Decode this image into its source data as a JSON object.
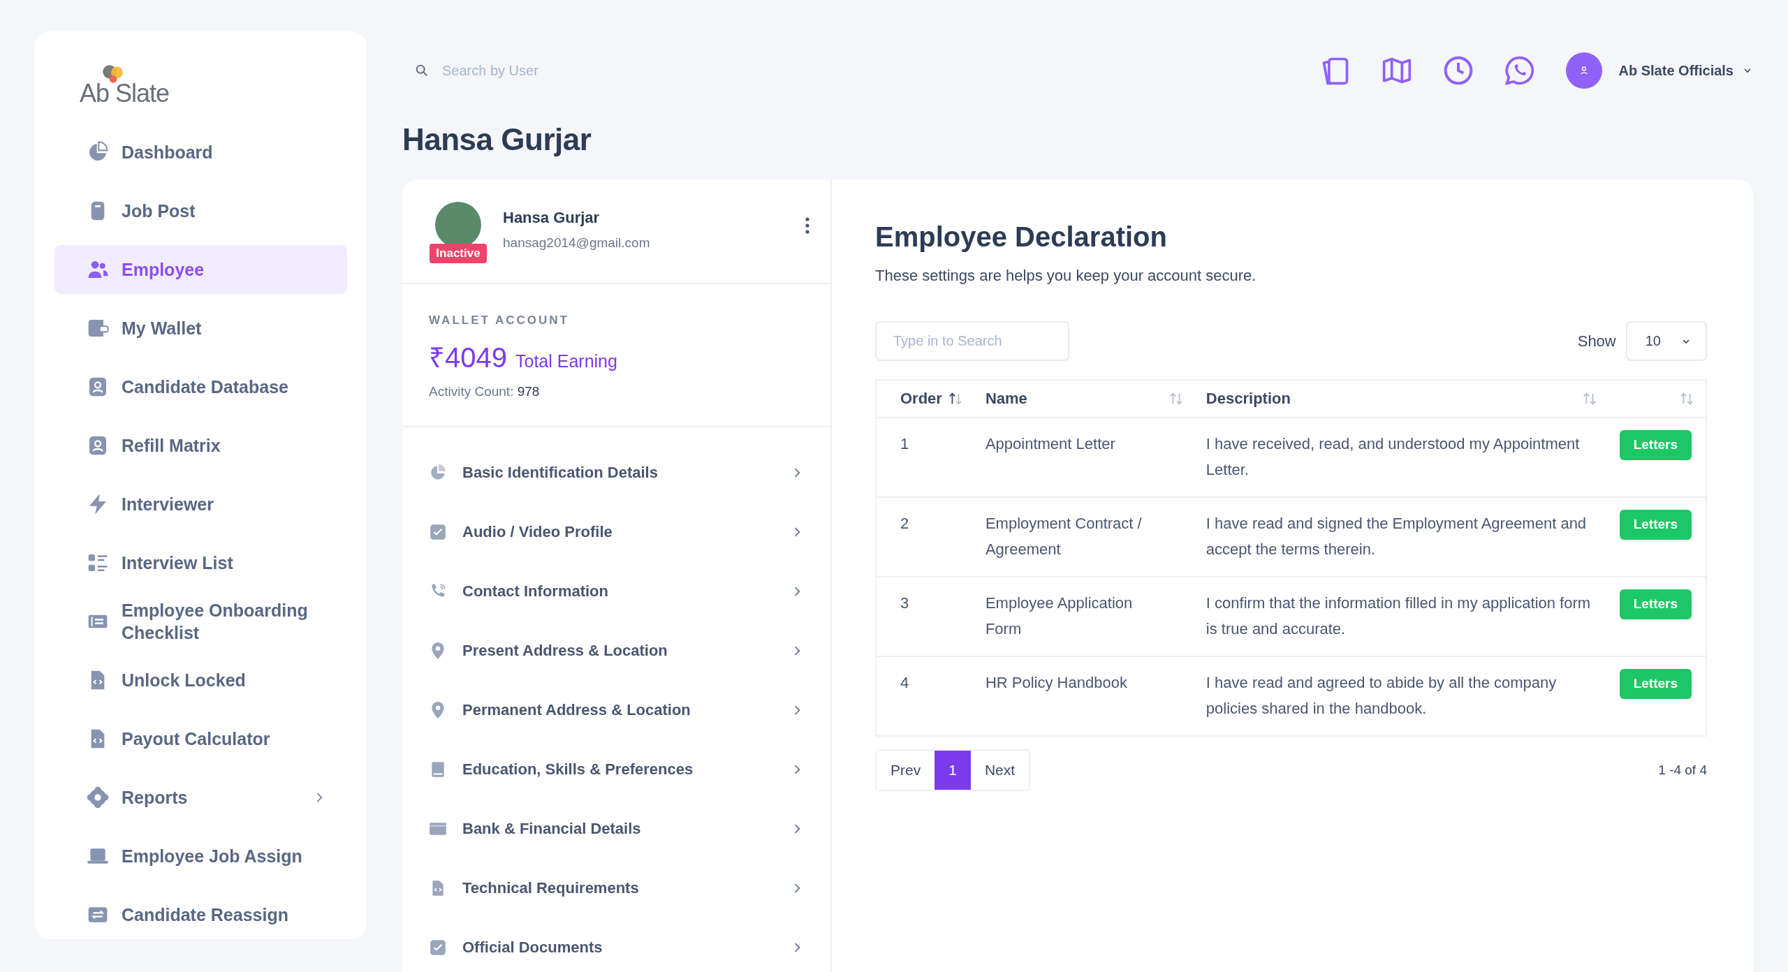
{
  "logo": {
    "text": "Ab Slate"
  },
  "sidebar": {
    "items": [
      {
        "label": "Dashboard",
        "selected": false,
        "expandable": false
      },
      {
        "label": "Job Post",
        "selected": false,
        "expandable": false
      },
      {
        "label": "Employee",
        "selected": true,
        "expandable": false
      },
      {
        "label": "My Wallet",
        "selected": false,
        "expandable": false
      },
      {
        "label": "Candidate Database",
        "selected": false,
        "expandable": false
      },
      {
        "label": "Refill Matrix",
        "selected": false,
        "expandable": false
      },
      {
        "label": "Interviewer",
        "selected": false,
        "expandable": false
      },
      {
        "label": "Interview List",
        "selected": false,
        "expandable": false
      },
      {
        "label": "Employee Onboarding Checklist",
        "selected": false,
        "expandable": false
      },
      {
        "label": "Unlock Locked",
        "selected": false,
        "expandable": false
      },
      {
        "label": "Payout Calculator",
        "selected": false,
        "expandable": false
      },
      {
        "label": "Reports",
        "selected": false,
        "expandable": true
      },
      {
        "label": "Employee Job Assign",
        "selected": false,
        "expandable": false
      },
      {
        "label": "Candidate Reassign",
        "selected": false,
        "expandable": false
      }
    ]
  },
  "topbar": {
    "search": {
      "placeholder": "Search by User"
    },
    "user": {
      "name": "Ab Slate Officials"
    }
  },
  "page_title": "Hansa Gurjar",
  "profile": {
    "name": "Hansa Gurjar",
    "email": "hansag2014@gmail.com",
    "status": {
      "label": "Inactive",
      "kind": "inactive"
    },
    "wallet": {
      "heading": "WALLET ACCOUNT",
      "amount": "₹4049",
      "amount_label": "Total Earning",
      "activity_label": "Activity Count:",
      "activity_value": "978"
    },
    "sections": [
      {
        "label": "Basic Identification Details"
      },
      {
        "label": "Audio / Video Profile"
      },
      {
        "label": "Contact Information"
      },
      {
        "label": "Present Address & Location"
      },
      {
        "label": "Permanent Address & Location"
      },
      {
        "label": "Education, Skills & Preferences"
      },
      {
        "label": "Bank & Financial Details"
      },
      {
        "label": "Technical Requirements"
      },
      {
        "label": "Official Documents"
      }
    ]
  },
  "declaration": {
    "title": "Employee Declaration",
    "subtitle": "These settings are helps you keep your account secure.",
    "search": {
      "placeholder": "Type in to Search"
    },
    "show_label": "Show",
    "page_size": "10",
    "columns": [
      {
        "label": "Order",
        "sorted": true
      },
      {
        "label": "Name",
        "sorted": false
      },
      {
        "label": "Description",
        "sorted": false
      },
      {
        "sorted": false
      }
    ],
    "rows": [
      {
        "order": "1",
        "name": "Appointment Letter",
        "description": "I have received, read, and understood my Appointment Letter.",
        "action": "Letters"
      },
      {
        "order": "2",
        "name": "Employment Contract / Agreement",
        "description": "I have read and signed the Employment Agreement and accept the terms therein.",
        "action": "Letters"
      },
      {
        "order": "3",
        "name": "Employee Application Form",
        "description": "I confirm that the information filled in my application form is true and accurate.",
        "action": "Letters"
      },
      {
        "order": "4",
        "name": "HR Policy Handbook",
        "description": "I have read and agreed to abide by all the company policies shared in the handbook.",
        "action": "Letters"
      }
    ],
    "pagination": {
      "prev": "Prev",
      "pages": [
        {
          "label": "1",
          "selected": true
        }
      ],
      "next": "Next"
    },
    "summary": "1 -4 of 4"
  }
}
